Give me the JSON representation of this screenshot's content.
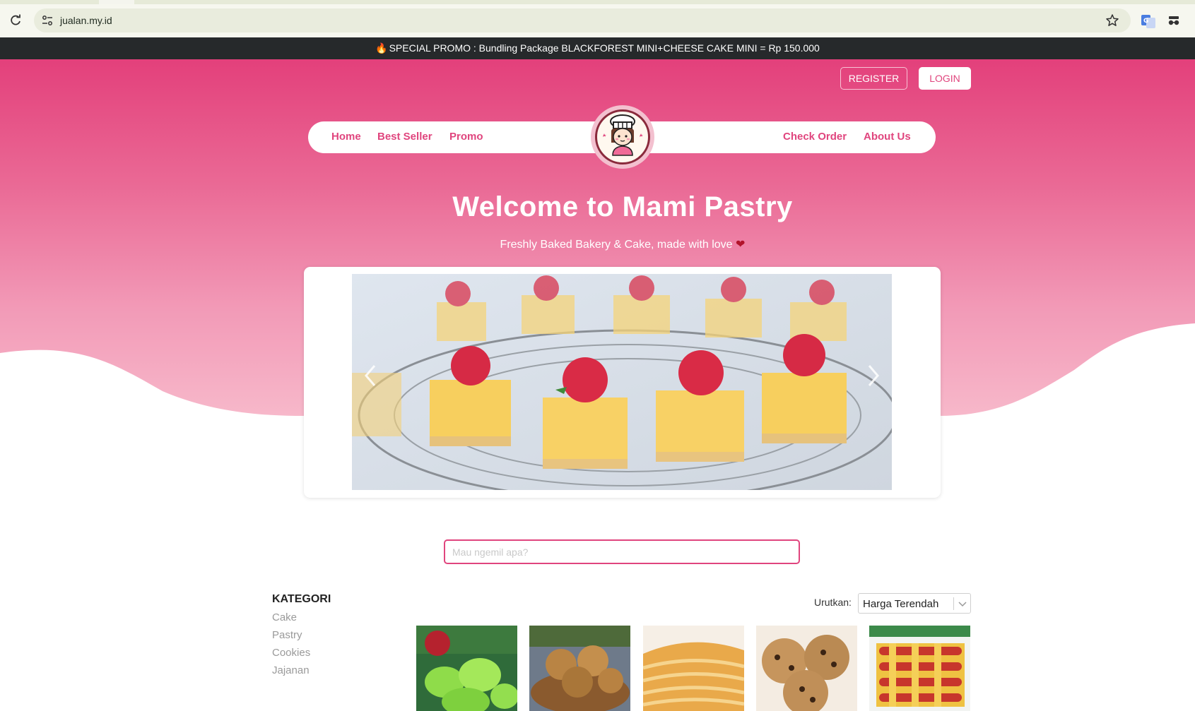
{
  "browser": {
    "url": "jualan.my.id"
  },
  "promo": {
    "text": "SPECIAL PROMO : Bundling Package BLACKFOREST MINI+CHEESE CAKE MINI = Rp 150.000",
    "icon": "fire-icon"
  },
  "auth": {
    "register_label": "REGISTER",
    "login_label": "LOGIN"
  },
  "nav": {
    "left": [
      "Home",
      "Best Seller",
      "Promo"
    ],
    "right": [
      "Check Order",
      "About Us"
    ],
    "logo_icon": "chef-girl-logo"
  },
  "hero": {
    "title": "Welcome to Mami Pastry",
    "subtitle": "Freshly Baked Bakery & Cake, made with love",
    "heart_icon": "heart-icon"
  },
  "carousel": {
    "image": "lemon-bars-raspberry-photo",
    "prev_icon": "chevron-left-icon",
    "next_icon": "chevron-right-icon"
  },
  "search": {
    "placeholder": "Mau ngemil apa?"
  },
  "categories": {
    "title": "KATEGORI",
    "items": [
      "Cake",
      "Pastry",
      "Cookies",
      "Jajanan"
    ]
  },
  "sort": {
    "label": "Urutkan:",
    "selected": "Harga Terendah"
  },
  "products": [
    {
      "image": "green-pandan-bundt-cakes-photo"
    },
    {
      "image": "sesame-balls-photo"
    },
    {
      "image": "flaky-pastry-photo"
    },
    {
      "image": "chocolate-chip-cookies-photo"
    },
    {
      "image": "woven-sausage-pastry-photo"
    }
  ],
  "colors": {
    "brand_pink": "#e0457e",
    "promo_bg": "#26292b",
    "hero_top": "#e3407b",
    "hero_bottom": "#f7b3c6"
  }
}
